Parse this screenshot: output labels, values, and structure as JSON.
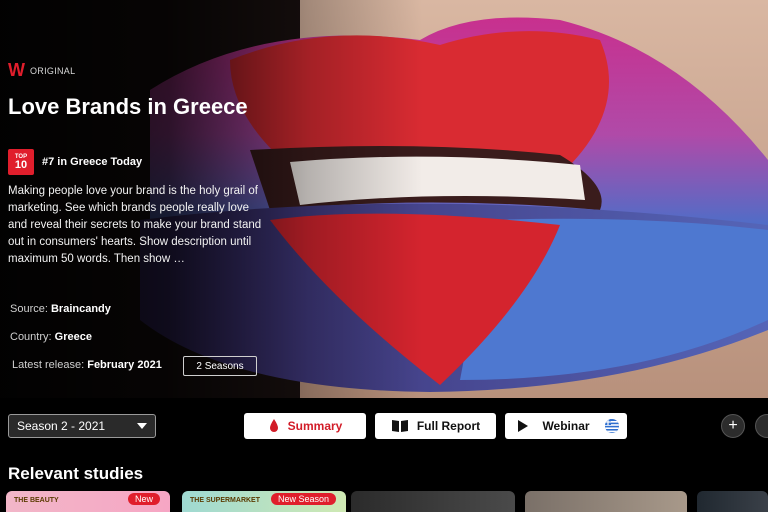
{
  "hero": {
    "brand_tag": "ORIGINAL",
    "title": "Love Brands in Greece",
    "rank_badge_top": "TOP",
    "rank_badge_num": "10",
    "rank_text": "#7 in Greece Today",
    "description": "Making people love your brand is the holy grail of marketing. See which brands people really love and reveal their secrets to make your brand stand out in consumers' hearts. Show description until maximum 50 words. Then show …",
    "source_label": "Source:",
    "source_value": "Braincandy",
    "country_label": "Country:",
    "country_value": "Greece",
    "release_label": "Latest release:",
    "release_value": "February 2021",
    "seasons_button": "2 Seasons"
  },
  "toolbar": {
    "season_select": "Season 2 - 2021",
    "summary_label": "Summary",
    "report_label": "Full Report",
    "webinar_label": "Webinar",
    "add_symbol": "+"
  },
  "relevant": {
    "title": "Relevant studies",
    "cards": [
      {
        "label": "THE BEAUTY",
        "badge": "New"
      },
      {
        "label": "THE SUPERMARKET",
        "badge": "New Season"
      },
      {
        "label": ""
      },
      {
        "label": ""
      },
      {
        "label": ""
      }
    ]
  },
  "colors": {
    "accent_red": "#e01e2c",
    "pill_bg": "#ffffff",
    "background": "#000000"
  },
  "icons": {
    "brand": "w-logo-icon",
    "summary": "drop-icon",
    "report": "book-icon",
    "webinar": "play-icon",
    "webinar_flag": "greece-flag-icon",
    "add": "plus-icon"
  }
}
